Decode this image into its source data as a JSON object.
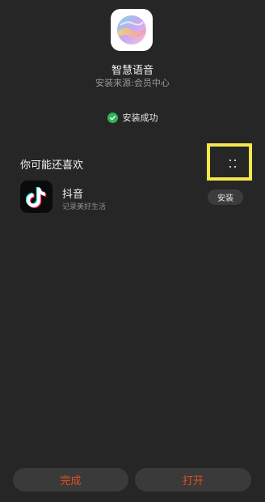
{
  "app": {
    "name": "智慧语音",
    "source": "安装来源:会员中心",
    "icon": "smart-voice-app-icon"
  },
  "status": {
    "text": "安装成功",
    "icon": "check-circle-icon",
    "color": "#2fb55a"
  },
  "recommendations": {
    "heading": "你可能还喜欢",
    "items": [
      {
        "name": "抖音",
        "description": "记录美好生活",
        "icon": "douyin-app-icon",
        "install_label": "安装"
      }
    ]
  },
  "actions": {
    "done_label": "完成",
    "open_label": "打开",
    "accent_color": "#e0501d"
  },
  "highlight_color": "#f5e84a"
}
